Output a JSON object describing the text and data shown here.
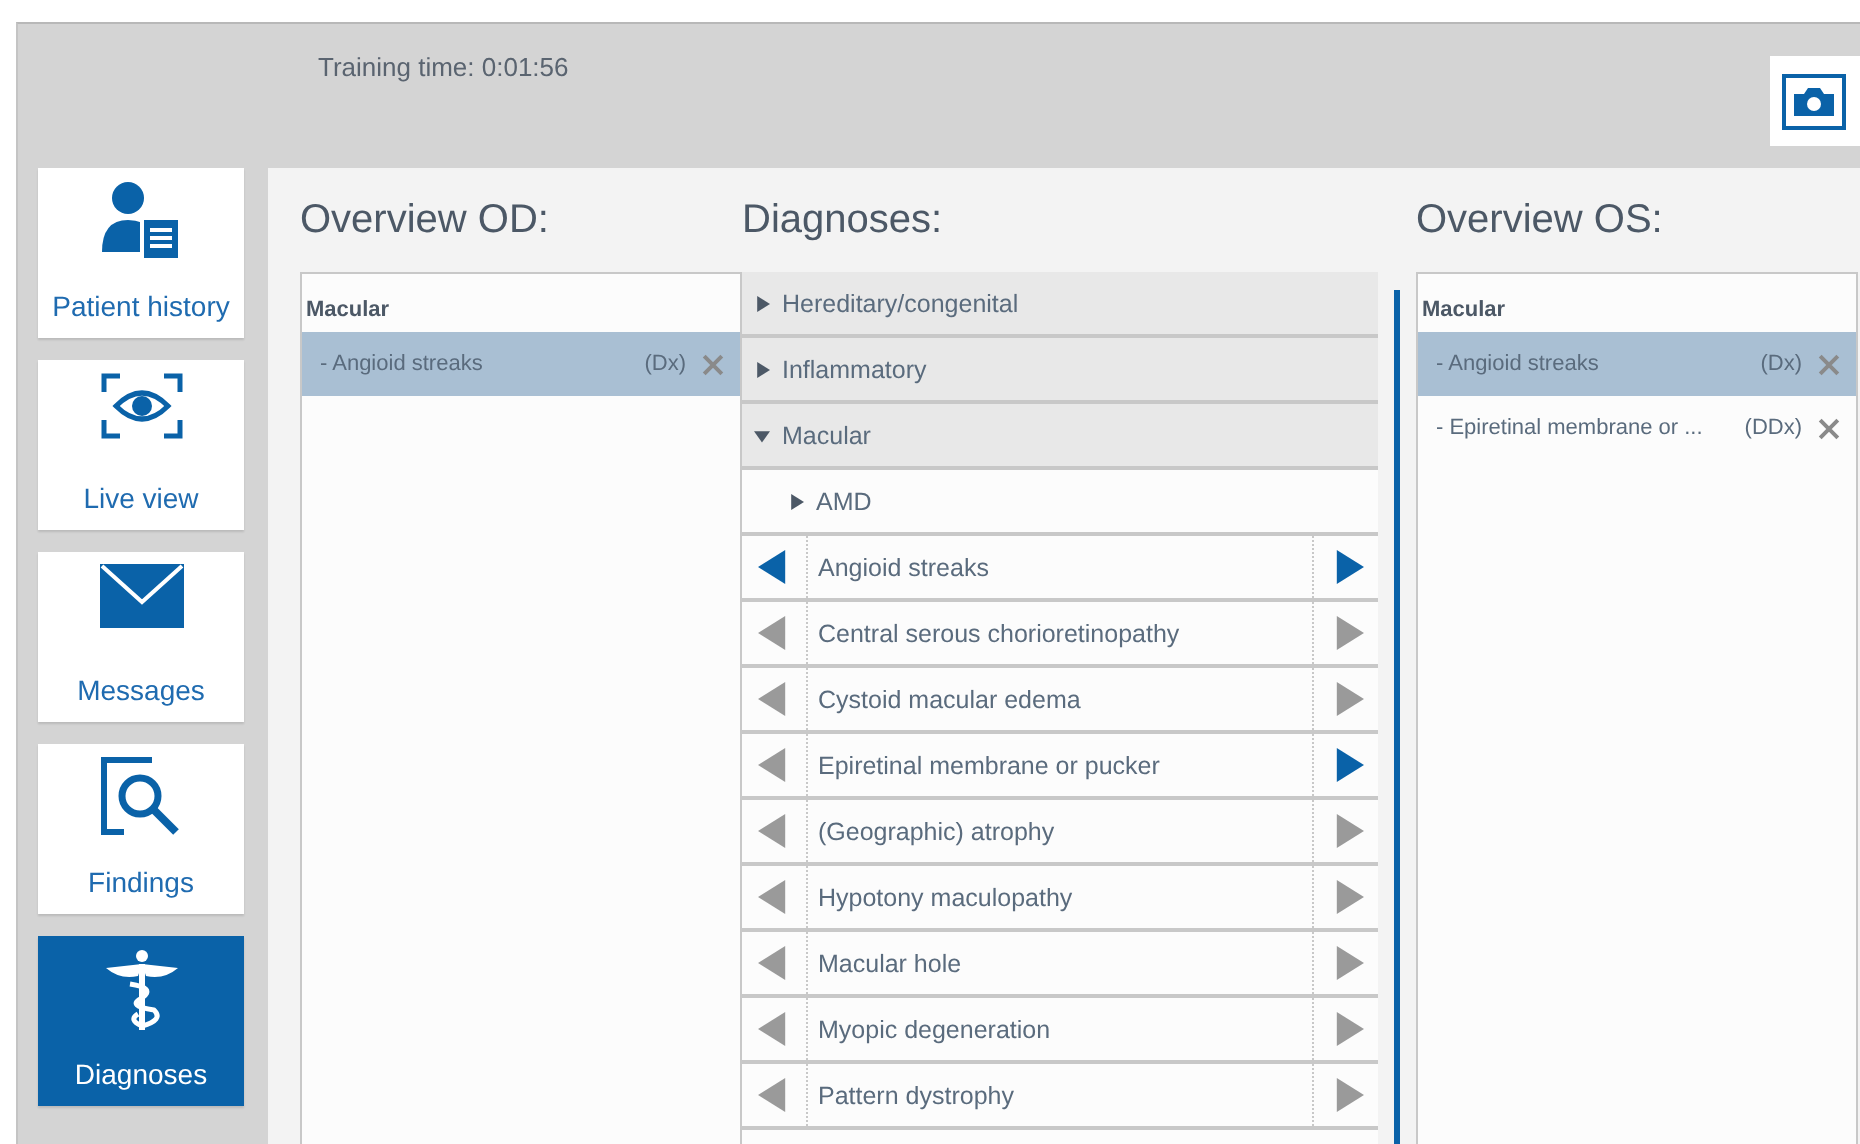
{
  "training_time": "Training time: 0:01:56",
  "sidebar": [
    {
      "label": "Patient history",
      "selected": false
    },
    {
      "label": "Live view",
      "selected": false
    },
    {
      "label": "Messages",
      "selected": false
    },
    {
      "label": "Findings",
      "selected": false
    },
    {
      "label": "Diagnoses",
      "selected": true
    }
  ],
  "overview_od": {
    "title": "Overview OD:",
    "groups": [
      {
        "label": "Macular",
        "items": [
          {
            "label": "- Angioid streaks",
            "tag": "(Dx)",
            "selected": true
          }
        ]
      }
    ]
  },
  "diagnoses": {
    "title": "Diagnoses:",
    "categories": [
      {
        "label": "Hereditary/congenital",
        "expanded": false
      },
      {
        "label": "Inflammatory",
        "expanded": false
      },
      {
        "label": "Macular",
        "expanded": true,
        "children": [
          {
            "kind": "group",
            "label": "AMD",
            "expanded": false
          },
          {
            "kind": "diagnosis",
            "label": "Angioid streaks",
            "od": true,
            "os": true
          },
          {
            "kind": "diagnosis",
            "label": "Central serous chorioretinopathy",
            "od": false,
            "os": false
          },
          {
            "kind": "diagnosis",
            "label": "Cystoid macular edema",
            "od": false,
            "os": false
          },
          {
            "kind": "diagnosis",
            "label": "Epiretinal membrane or pucker",
            "od": false,
            "os": true
          },
          {
            "kind": "diagnosis",
            "label": "(Geographic) atrophy",
            "od": false,
            "os": false
          },
          {
            "kind": "diagnosis",
            "label": "Hypotony maculopathy",
            "od": false,
            "os": false
          },
          {
            "kind": "diagnosis",
            "label": "Macular hole",
            "od": false,
            "os": false
          },
          {
            "kind": "diagnosis",
            "label": "Myopic degeneration",
            "od": false,
            "os": false
          },
          {
            "kind": "diagnosis",
            "label": "Pattern dystrophy",
            "od": false,
            "os": false
          }
        ]
      }
    ]
  },
  "overview_os": {
    "title": "Overview OS:",
    "groups": [
      {
        "label": "Macular",
        "items": [
          {
            "label": "- Angioid streaks",
            "tag": "(Dx)",
            "selected": true
          },
          {
            "label": "- Epiretinal membrane or ...",
            "tag": "(DDx)",
            "selected": false
          }
        ]
      }
    ]
  }
}
